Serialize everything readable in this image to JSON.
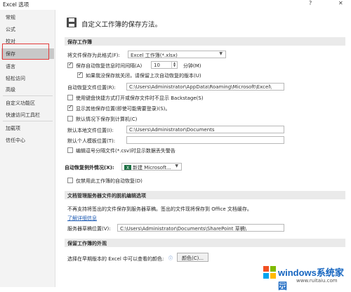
{
  "title_bar": {
    "title": "Excel 选项",
    "help": "?",
    "close": "✕"
  },
  "sidebar": {
    "items": [
      {
        "label": "常规"
      },
      {
        "label": "公式"
      },
      {
        "label": "校对"
      },
      {
        "label": "保存",
        "active": true
      },
      {
        "label": "语言"
      },
      {
        "label": "轻松访问"
      },
      {
        "label": "高级"
      },
      {
        "label": "自定义功能区"
      },
      {
        "label": "快速访问工具栏"
      },
      {
        "label": "加载项"
      },
      {
        "label": "信任中心"
      }
    ]
  },
  "header": {
    "title": "自定义工作簿的保存方法。"
  },
  "save_workbooks": {
    "section_title": "保存工作簿",
    "format_label": "将文件保存为此格式(F):",
    "format_value": "Excel 工作簿(*.xlsx)",
    "autorecover_label": "保存自动恢复信息时间间隔(A)",
    "autorecover_checked": true,
    "autorecover_minutes": "10",
    "minutes_label": "分钟(M)",
    "keep_last_label": "如果我没保存就关闭，请保留上次自动恢复的版本(U)",
    "keep_last_checked": true,
    "autorecover_location_label": "自动恢复文件位置(R):",
    "autorecover_location_value": "C:\\Users\\Administrator\\AppData\\Roaming\\Microsoft\\Excel\\",
    "no_backstage_label": "使用键盘快捷方式打开或保存文件时不显示 Backstage(S)",
    "no_backstage_checked": false,
    "show_additional_label": "显示其他保存位置(即使可能需要登录)(S)。",
    "show_additional_checked": true,
    "default_computer_label": "默认情况下保存到计算机(C)",
    "default_computer_checked": false,
    "default_local_label": "默认本地文件位置(I):",
    "default_local_value": "C:\\Users\\Administrator\\Documents",
    "default_template_label": "默认个人模板位置(T):",
    "default_template_value": "",
    "csv_warning_label": "编辑逗号分隔文件(*.csv)时显示数据丢失警告",
    "csv_warning_checked": false
  },
  "autorecover_exceptions": {
    "label": "自动恢复例外情况(X):",
    "workbook_value": "新建 Microsoft...",
    "disable_label": "仅禁用此工作簿的自动恢复(D)",
    "disable_checked": false
  },
  "offline_editing": {
    "section_title": "文档管理服务器文件的脱机编辑选项",
    "description": "不再支持将签出的文件保存到服务器草稿。签出的文件现将保存到 Office 文档缓存。",
    "learn_more": "了解详细信息",
    "drafts_label": "服务器草稿位置(V):",
    "drafts_value": "C:\\Users\\Administrator\\Documents\\SharePoint 草稿\\"
  },
  "preserve_appearance": {
    "section_title": "保留工作簿的外观",
    "colors_label": "选择在早期版本的 Excel 中可以查看的颜色:",
    "info_icon": "ⓘ",
    "colors_button": "颜色(C)..."
  },
  "watermark": {
    "brand": "windows系统家园",
    "site": "www.ruitaiu.com"
  },
  "colors": {
    "active_nav": "#c8c8c8",
    "highlight_border": "#e23a3a",
    "link": "#1e5bb3",
    "excel_green": "#1e7145"
  }
}
